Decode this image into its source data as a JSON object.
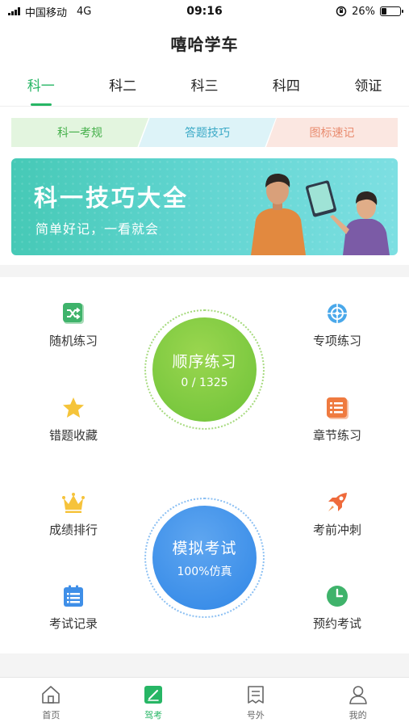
{
  "status_bar": {
    "carrier": "中国移动",
    "network": "4G",
    "time": "09:16",
    "battery": "26%",
    "battery_level": 0.26
  },
  "header": {
    "title": "嘻哈学车"
  },
  "tabs": [
    {
      "label": "科一",
      "active": true
    },
    {
      "label": "科二",
      "active": false
    },
    {
      "label": "科三",
      "active": false
    },
    {
      "label": "科四",
      "active": false
    },
    {
      "label": "领证",
      "active": false
    }
  ],
  "subtabs": [
    {
      "label": "科一考规"
    },
    {
      "label": "答题技巧"
    },
    {
      "label": "图标速记"
    }
  ],
  "banner": {
    "title": "科一技巧大全",
    "subtitle": "简单好记，一看就会"
  },
  "practice": {
    "left_top": [
      {
        "label": "随机练习",
        "icon": "shuffle-icon"
      },
      {
        "label": "错题收藏",
        "icon": "star-icon"
      }
    ],
    "right_top": [
      {
        "label": "专项练习",
        "icon": "target-icon"
      },
      {
        "label": "章节练习",
        "icon": "chapter-list-icon"
      }
    ],
    "main_circle": {
      "title": "顺序练习",
      "progress": "0 / 1325"
    },
    "left_bottom": [
      {
        "label": "成绩排行",
        "icon": "crown-icon"
      },
      {
        "label": "考试记录",
        "icon": "record-list-icon"
      }
    ],
    "right_bottom": [
      {
        "label": "考前冲刺",
        "icon": "rocket-icon"
      },
      {
        "label": "预约考试",
        "icon": "clock-icon"
      }
    ],
    "exam_circle": {
      "title": "模拟考试",
      "subtitle": "100%仿真"
    }
  },
  "bottom_nav": [
    {
      "label": "首页",
      "icon": "home-icon",
      "active": false
    },
    {
      "label": "驾考",
      "icon": "exam-icon",
      "active": true
    },
    {
      "label": "号外",
      "icon": "news-icon",
      "active": false
    },
    {
      "label": "我的",
      "icon": "profile-icon",
      "active": false
    }
  ],
  "colors": {
    "accent": "#27b665",
    "practice_circle": "#7ccb3c",
    "exam_circle": "#3b8ee8"
  }
}
